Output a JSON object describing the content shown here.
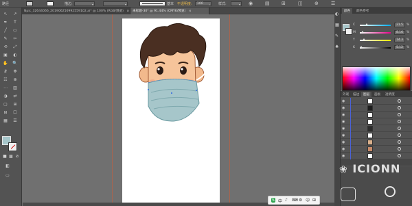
{
  "controlbar": {
    "selection_label": "路径",
    "stroke_label": "描边:",
    "basic_label": "基本",
    "opacity_label": "不透明度:",
    "opacity_value": "100",
    "style_label": "样式:",
    "icons": [
      "arrow-down-icon",
      "grid-icon",
      "globe-icon",
      "align-icon"
    ]
  },
  "tabs": [
    {
      "label": "Npic_32644066_201906250992559102.ai* @ 100% (RGB/预览)",
      "active": false
    },
    {
      "label": "未标题-30* @ 91.44% (CMYK/预览)",
      "active": true
    }
  ],
  "tab_close": "×",
  "tools": [
    "↖",
    "↗",
    "✒",
    "T",
    "╱",
    "▭",
    "✎",
    "✂",
    "⟲",
    "⤢",
    "▣",
    "◐",
    "✋",
    "🔍",
    "⇵",
    "✥",
    "☷",
    "⊕",
    "⋯",
    "▥",
    "◑",
    "⇄",
    "▢",
    "⊞",
    "⊟",
    "☐",
    "▦",
    "☰"
  ],
  "color_panel": {
    "channels": [
      {
        "label": "C",
        "value": "21.5",
        "unit": "%",
        "knob": 0.22,
        "gradient": "linear-gradient(to right,#ffffff,#00aeef)"
      },
      {
        "label": "M",
        "value": "8.16",
        "unit": "%",
        "knob": 0.08,
        "gradient": "linear-gradient(to right,#ffffff,#ec008c)"
      },
      {
        "label": "Y",
        "value": "14.3",
        "unit": "%",
        "knob": 0.14,
        "gradient": "linear-gradient(to right,#ffffff,#fff200)"
      },
      {
        "label": "K",
        "value": "5.12",
        "unit": "%",
        "knob": 0.05,
        "gradient": "linear-gradient(to right,#ffffff,#000000)"
      }
    ],
    "fill_color": "#a6c6ca"
  },
  "right_tabs_top": [
    "颜色",
    "颜色参考"
  ],
  "right_tabs_layers": [
    "外观",
    "描边",
    "图层",
    "画板",
    "透明度"
  ],
  "layers": {
    "rows": 9,
    "thumb_colors": [
      "#ffffff",
      "#1d1d1d",
      "#ffffff",
      "#ffffff",
      "#2b2b2b",
      "#ffffff",
      "#d9b08c",
      "#c98c6a",
      "#ffffff"
    ]
  },
  "watermark": "ICIONN",
  "tray": {
    "items": [
      "S",
      "中",
      "♪",
      "⌨",
      "⚙",
      "☺",
      "⊞"
    ]
  }
}
